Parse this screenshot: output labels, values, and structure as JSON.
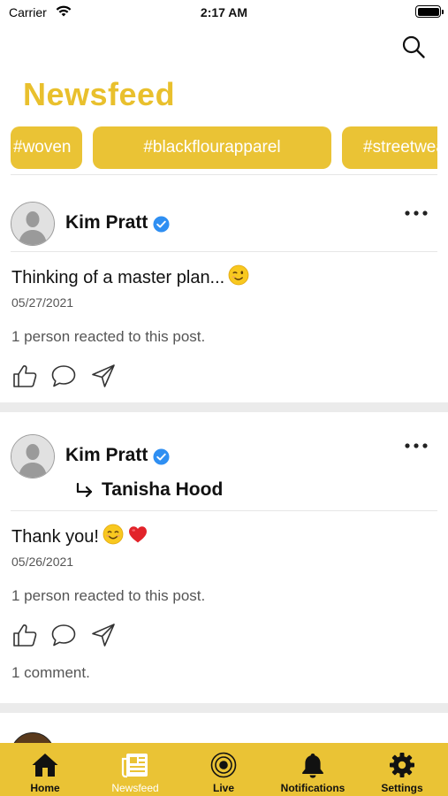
{
  "status_bar": {
    "carrier": "Carrier",
    "time": "2:17 AM"
  },
  "header": {
    "title": "Newsfeed"
  },
  "hashtags": [
    "#woven",
    "#blackflourapparel",
    "#streetwear"
  ],
  "posts": [
    {
      "author": "Kim Pratt",
      "verified": true,
      "text": "Thinking of a master plan...",
      "emojis": [
        "winking-face"
      ],
      "date": "05/27/2021",
      "reactions": "1 person reacted to this post."
    },
    {
      "author": "Kim Pratt",
      "verified": true,
      "shared_with": "Tanisha Hood",
      "text": "Thank you!",
      "emojis": [
        "smiling-face",
        "red-heart"
      ],
      "date": "05/26/2021",
      "reactions": "1 person reacted to this post.",
      "comments": "1 comment."
    }
  ],
  "tabs": [
    {
      "label": "Home",
      "icon": "home-icon",
      "active": false
    },
    {
      "label": "Newsfeed",
      "icon": "newspaper-icon",
      "active": true
    },
    {
      "label": "Live",
      "icon": "live-icon",
      "active": false
    },
    {
      "label": "Notifications",
      "icon": "bell-icon",
      "active": false
    },
    {
      "label": "Settings",
      "icon": "gear-icon",
      "active": false
    }
  ],
  "colors": {
    "accent": "#eac335",
    "title": "#e9c02d",
    "verified": "#2f8ff2",
    "separator": "#ebebeb"
  }
}
